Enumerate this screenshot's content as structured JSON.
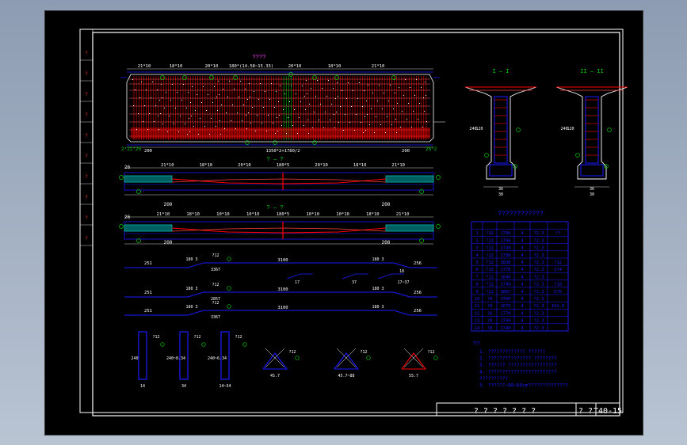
{
  "title_block": {
    "drawing_name": "? ? ? ? ? ? ?",
    "drawing_no_label": "? ?",
    "drawing_no": "T40-15"
  },
  "margin_labels": [
    "?",
    "?",
    "?",
    "?",
    "?",
    "?",
    "?",
    "?",
    "?",
    "?"
  ],
  "elevation": {
    "title": "????",
    "dims_top": [
      "21*10",
      "18*10",
      "20*10",
      "180*(14.58~15.33)",
      "20*10",
      "18*10",
      "21*10"
    ],
    "dims_bottom": [
      "200",
      "1350*2+1780/2",
      "200"
    ],
    "end_label_left": "2*21*25",
    "end_label_right": "25*2"
  },
  "plan_views": [
    {
      "title": "? — ?",
      "dims": [
        "21*10",
        "18*10",
        "20*10",
        "180*5",
        "20*10",
        "18*10",
        "21*10"
      ],
      "end_dims": [
        "200",
        "200"
      ],
      "end_mark": "26"
    },
    {
      "title": "? — ?",
      "dims": [
        "21*10",
        "18*10",
        "10*10",
        "10*10",
        "180*5",
        "10*10",
        "10*10",
        "18*10",
        "21*10"
      ],
      "end_dims": [
        "200",
        "200"
      ],
      "end_mark": "26"
    }
  ],
  "rebar_rows": [
    {
      "left": "251",
      "mid": "3100",
      "right": "256",
      "tag1": "180 3",
      "tag2": "180 3",
      "bend": "?12",
      "bend2": "3367"
    },
    {
      "left": "",
      "mid": "",
      "right": "",
      "tag1": "17",
      "tag2": "37",
      "bend": "18",
      "bend2": "17~37"
    },
    {
      "left": "251",
      "mid": "3100",
      "right": "256",
      "tag1": "180 3",
      "tag2": "180 3",
      "bend": "?12",
      "bend2": "2857"
    },
    {
      "left": "251",
      "mid": "3100",
      "right": "256",
      "tag1": "180 3",
      "tag2": "180 3",
      "bend": "?12",
      "bend2": "3367"
    }
  ],
  "stirrups": [
    {
      "dim": "240",
      "sub": "14",
      "tag": "?12"
    },
    {
      "dim": "240~8.34",
      "sub": "34",
      "tag": "?12"
    },
    {
      "dim": "240~6.34",
      "sub": "14~34",
      "tag": "?12"
    }
  ],
  "triangles": [
    {
      "sub": "45.7",
      "tag": "?12"
    },
    {
      "sub": "45.7~88",
      "tag": "?12"
    },
    {
      "sub": "55.7",
      "tag": "?12"
    }
  ],
  "sections": [
    {
      "title": "I — I",
      "dims": [
        "240",
        "120",
        "36",
        "30"
      ]
    },
    {
      "title": "II — II",
      "dims": [
        "240",
        "120",
        "36",
        "30"
      ]
    }
  ],
  "table": {
    "title": "????????????",
    "rows": [
      [
        "1",
        "?12",
        "1700",
        "4",
        "?2.3",
        "??"
      ],
      [
        "2",
        "?12",
        "1706",
        "4",
        "?2.3",
        ""
      ],
      [
        "3",
        "?12",
        "1748",
        "4",
        "?2.3",
        ""
      ],
      [
        "4",
        "?12",
        "1790",
        "4",
        "?2.3",
        ""
      ],
      [
        "5",
        "?12",
        "2836",
        "4",
        "?2.3",
        "?12"
      ],
      [
        "6",
        "?12",
        "1770",
        "4",
        "?2.3",
        "3?4"
      ],
      [
        "7",
        "?12",
        "1640",
        "4",
        "?2.3",
        ""
      ],
      [
        "8",
        "?12",
        "1740",
        "4",
        "?2.3",
        "?10"
      ],
      [
        "9",
        "?12",
        "3867",
        "4",
        "?2.3",
        "5?6"
      ],
      [
        "10",
        "?8",
        "1700",
        "4",
        "?2.3",
        ""
      ],
      [
        "11",
        "?8",
        "1670",
        "4",
        "?2.3",
        "341.8"
      ],
      [
        "12",
        "?8",
        "1770",
        "4",
        "?2.3",
        ""
      ],
      [
        "13",
        "?8",
        "1700",
        "4",
        "?2.3",
        ""
      ],
      [
        "14",
        "?8",
        "1740",
        "4",
        "?2.3",
        ""
      ]
    ]
  },
  "notes": {
    "title": "??",
    "items": [
      "1.  ????????????? ??????",
      "2.  ??????????????? ????????",
      "3.  ?????? ?????????????????",
      "4.  ????????????????????????",
      "     ??????????",
      "5.  ??????~60~60cm??????????????"
    ]
  },
  "colors": {
    "red": "#ff0000",
    "blue": "#1a1aff",
    "green": "#00d000",
    "white": "#ffffff",
    "magenta": "#ff40ff",
    "grid": "#e00000"
  }
}
